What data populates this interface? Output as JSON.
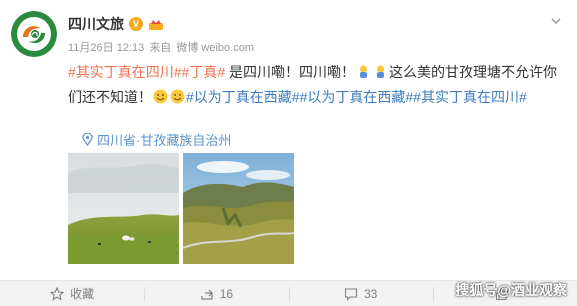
{
  "post": {
    "author": "四川文旅",
    "verified_badge": "V",
    "date": "11月26日 12:13",
    "source_prefix": "来自",
    "source": "微博 weibo.com",
    "text": {
      "tag1": "#其实丁真在四川#",
      "tag2": "#丁真#",
      "seg1": " 是四川嘞！四川嘞！",
      "seg2": "这么美的甘孜理塘不允许你们还不知道！",
      "tag3": "#以为丁真在西藏#",
      "tag4": "#以为丁真在西藏#",
      "tag5": "#其实丁真在四川#"
    },
    "location": "四川省·甘孜藏族自治州",
    "photos": [
      "grassland-camp-photo",
      "mountain-valley-photo"
    ]
  },
  "actions": {
    "favorite": "收藏",
    "repost": "16",
    "comment": "33",
    "like": ""
  },
  "watermark": "搜狐号@酒业观察",
  "colors": {
    "tag_orange": "#eb7350",
    "tag_blue": "#3f7bbf",
    "badge": "#f6ab23",
    "location": "#5d95cc"
  }
}
